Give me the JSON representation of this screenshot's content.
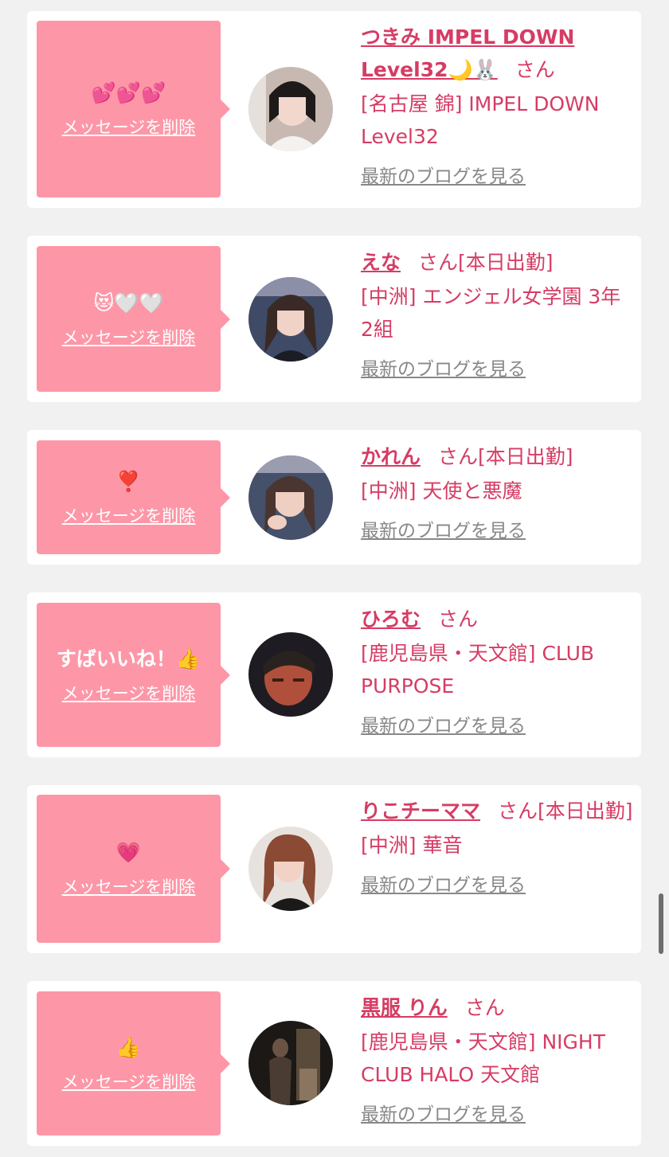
{
  "common": {
    "delete_label": "メッセージを削除",
    "blog_label": "最新のブログを見る",
    "honorific": "さん"
  },
  "colors": {
    "background": "#f1f1f1",
    "bubble": "#fd97a7",
    "accent_text": "#d63c64",
    "link_gray": "#888888"
  },
  "messages": [
    {
      "reaction": "💕💕💕",
      "name": "つきみ IMPEL DOWN Level32🌙🐰",
      "status": "",
      "shop": "[名古屋 錦] IMPEL DOWN Level32",
      "avatar_icon": "cast-photo-avatar"
    },
    {
      "reaction": "😻🤍🤍",
      "name": "えな",
      "status": "[本日出勤]",
      "shop": "[中洲] エンジェル女学園 3年2組",
      "avatar_icon": "cast-photo-avatar"
    },
    {
      "reaction": "❣️",
      "name": "かれん",
      "status": "[本日出勤]",
      "shop": "[中洲] 天使と悪魔",
      "avatar_icon": "cast-photo-avatar"
    },
    {
      "reaction": "すばいいね！👍",
      "name": "ひろむ",
      "status": "",
      "shop": "[鹿児島県・天文館] CLUB PURPOSE",
      "avatar_icon": "cast-photo-avatar"
    },
    {
      "reaction": "💗",
      "name": "りこチーママ",
      "status": "[本日出勤]",
      "shop": "[中洲] 華音",
      "avatar_icon": "cast-photo-avatar"
    },
    {
      "reaction": "👍",
      "name": "黒服 りん",
      "status": "",
      "shop": "[鹿児島県・天文館] NIGHT CLUB HALO 天文館",
      "avatar_icon": "cast-photo-avatar"
    }
  ]
}
